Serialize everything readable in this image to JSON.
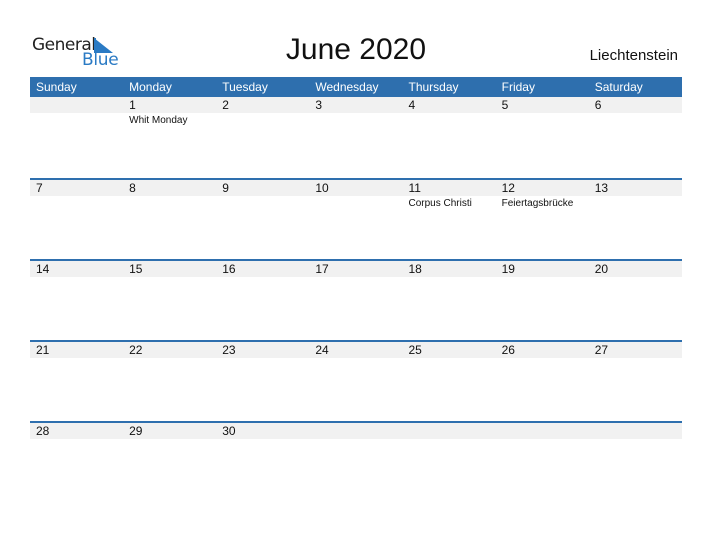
{
  "logo": {
    "general": "General",
    "blue": "Blue",
    "brand_color": "#2a7ac4"
  },
  "title": "June 2020",
  "country": "Liechtenstein",
  "header_color": "#2e6fae",
  "weekdays": [
    "Sunday",
    "Monday",
    "Tuesday",
    "Wednesday",
    "Thursday",
    "Friday",
    "Saturday"
  ],
  "weeks": [
    [
      {
        "n": "",
        "h": ""
      },
      {
        "n": "1",
        "h": "Whit Monday"
      },
      {
        "n": "2",
        "h": ""
      },
      {
        "n": "3",
        "h": ""
      },
      {
        "n": "4",
        "h": ""
      },
      {
        "n": "5",
        "h": ""
      },
      {
        "n": "6",
        "h": ""
      }
    ],
    [
      {
        "n": "7",
        "h": ""
      },
      {
        "n": "8",
        "h": ""
      },
      {
        "n": "9",
        "h": ""
      },
      {
        "n": "10",
        "h": ""
      },
      {
        "n": "11",
        "h": "Corpus Christi"
      },
      {
        "n": "12",
        "h": "Feiertagsbrücke"
      },
      {
        "n": "13",
        "h": ""
      }
    ],
    [
      {
        "n": "14",
        "h": ""
      },
      {
        "n": "15",
        "h": ""
      },
      {
        "n": "16",
        "h": ""
      },
      {
        "n": "17",
        "h": ""
      },
      {
        "n": "18",
        "h": ""
      },
      {
        "n": "19",
        "h": ""
      },
      {
        "n": "20",
        "h": ""
      }
    ],
    [
      {
        "n": "21",
        "h": ""
      },
      {
        "n": "22",
        "h": ""
      },
      {
        "n": "23",
        "h": ""
      },
      {
        "n": "24",
        "h": ""
      },
      {
        "n": "25",
        "h": ""
      },
      {
        "n": "26",
        "h": ""
      },
      {
        "n": "27",
        "h": ""
      }
    ],
    [
      {
        "n": "28",
        "h": ""
      },
      {
        "n": "29",
        "h": ""
      },
      {
        "n": "30",
        "h": ""
      },
      {
        "n": "",
        "h": ""
      },
      {
        "n": "",
        "h": ""
      },
      {
        "n": "",
        "h": ""
      },
      {
        "n": "",
        "h": ""
      }
    ]
  ]
}
